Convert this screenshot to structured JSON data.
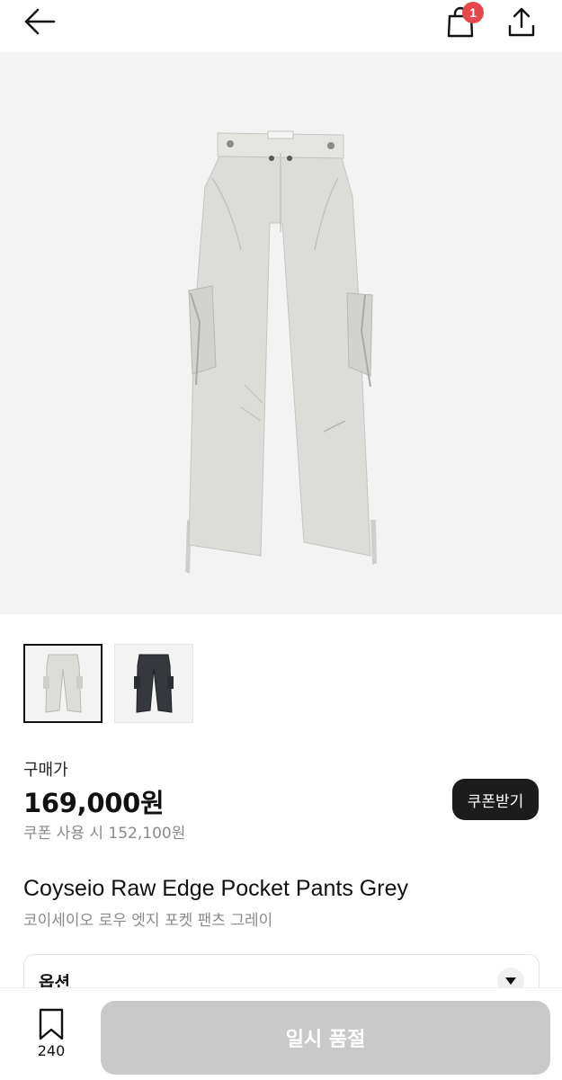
{
  "header": {
    "back_icon": "arrow-left-icon",
    "cart_icon": "shopping-bag-icon",
    "cart_count": "1",
    "share_icon": "share-upload-icon"
  },
  "product": {
    "price_label": "구매가",
    "price": "169,000원",
    "coupon_price_text": "쿠폰 사용 시 152,100원",
    "coupon_button": "쿠폰받기",
    "title_en": "Coyseio Raw Edge Pocket Pants Grey",
    "title_ko": "코이세이오 로우 엣지 포켓 팬츠 그레이",
    "brand_tag": "COYSEIO"
  },
  "thumbnails": [
    {
      "color": "grey",
      "selected": true
    },
    {
      "color": "charcoal",
      "selected": false
    }
  ],
  "options": {
    "label": "옵션"
  },
  "bottom_bar": {
    "wish_icon": "bookmark-icon",
    "wish_count": "240",
    "soldout_label": "일시 품절"
  },
  "colors": {
    "badge": "#e5474b",
    "soldout_button": "#c9c9c9",
    "coupon_button": "#1c1c1c",
    "pants_grey": "#dcdcd8",
    "pants_dark": "#35383d"
  }
}
